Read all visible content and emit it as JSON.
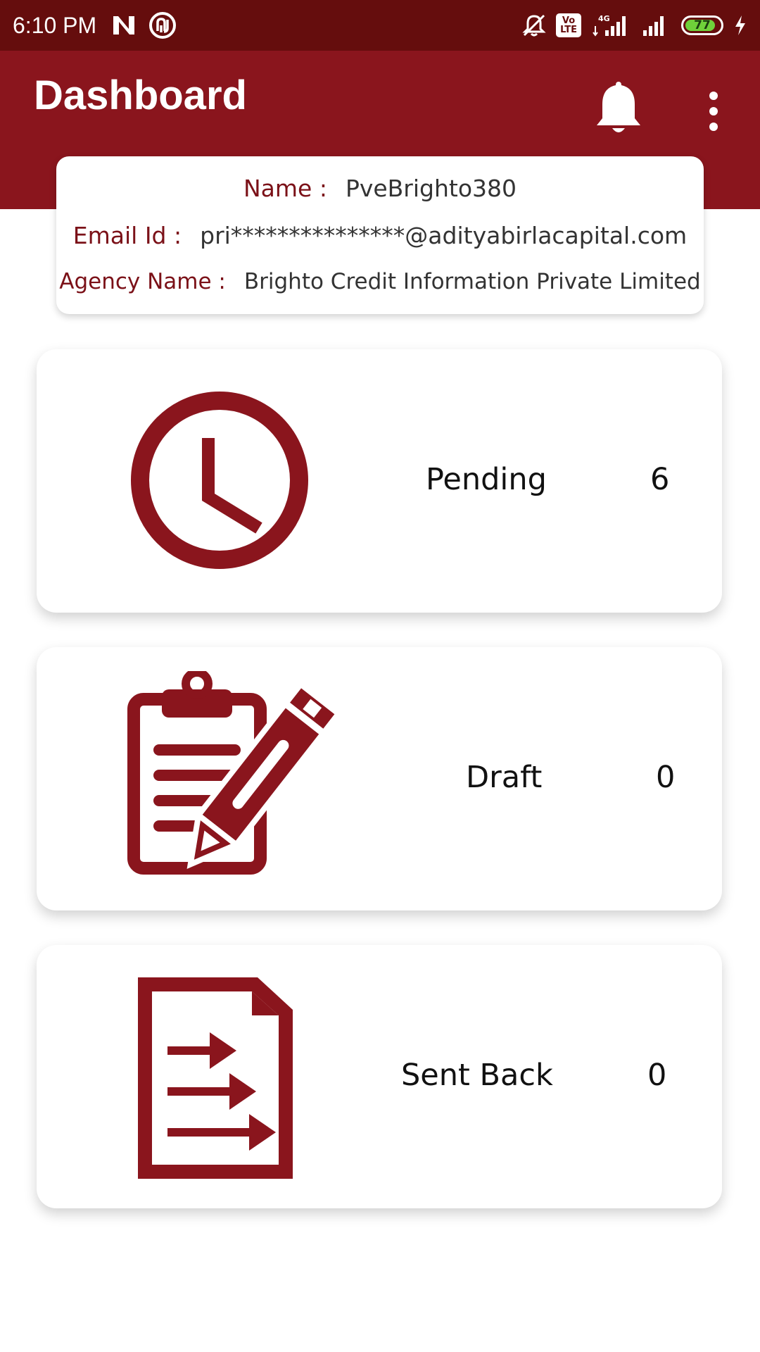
{
  "status_bar": {
    "time": "6:10 PM",
    "volte_label": "Vo\nLTE",
    "network_label": "4G",
    "battery_level": "77"
  },
  "app_bar": {
    "title": "Dashboard"
  },
  "profile": {
    "name_label": "Name :",
    "name_value": "PveBrighto380",
    "email_label": "Email Id :",
    "email_value": "pri***************@adityabirlacapital.com",
    "agency_label": "Agency Name :",
    "agency_value": "Brighto Credit Information Private Limited"
  },
  "stats": [
    {
      "label": "Pending",
      "count": "6",
      "icon": "clock-icon"
    },
    {
      "label": "Draft",
      "count": "0",
      "icon": "clipboard-pencil-icon"
    },
    {
      "label": "Sent Back",
      "count": "0",
      "icon": "document-arrows-icon"
    }
  ],
  "colors": {
    "status_bar": "#650d0d",
    "app_bar": "#8a151d",
    "accent": "#8a151d",
    "label": "#7b1118"
  }
}
